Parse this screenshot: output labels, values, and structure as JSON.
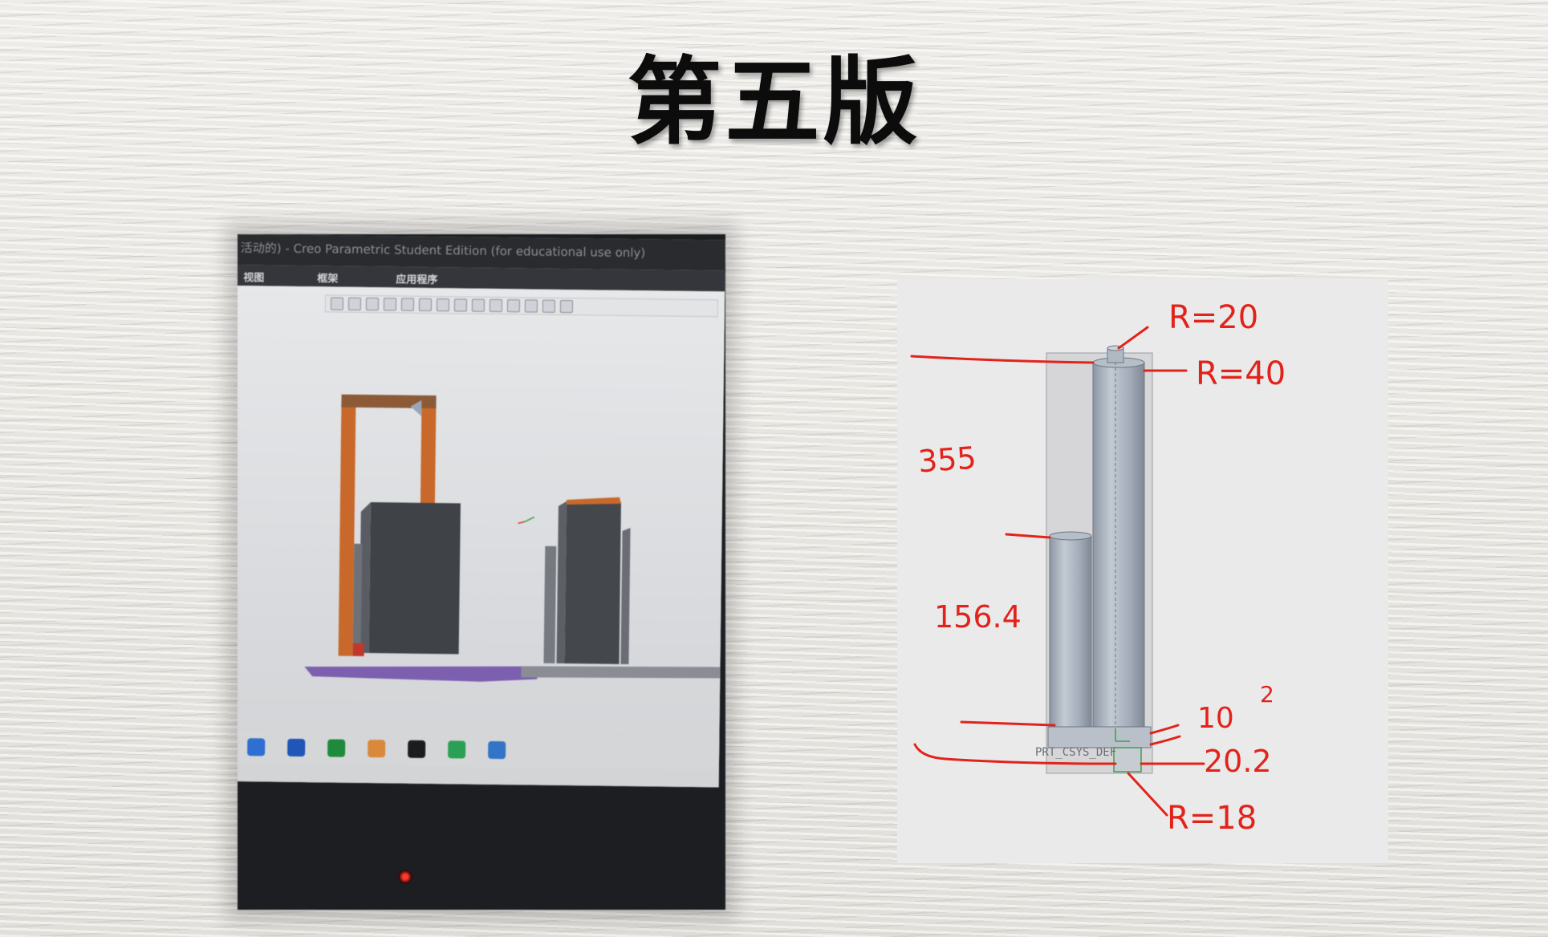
{
  "slide": {
    "title": "第五版"
  },
  "photo": {
    "window_title": "活动的) - Creo Parametric Student Edition (for educational use only)",
    "menu": [
      "视图",
      "框架",
      "应用程序"
    ]
  },
  "cad": {
    "csys_label": "PRT_CSYS_DEF",
    "annotations": {
      "r_top": "R=20",
      "r_main": "R=40",
      "height_total": "355",
      "height_short": "156.4",
      "base_thickness": "10",
      "base_sup": "2",
      "bottom_dim": "20.2",
      "r_bottom": "R=18"
    },
    "colors": {
      "annotation": "#e2231a",
      "cylinder": "#aab3bf",
      "viewport": "#eaeaeb"
    }
  }
}
